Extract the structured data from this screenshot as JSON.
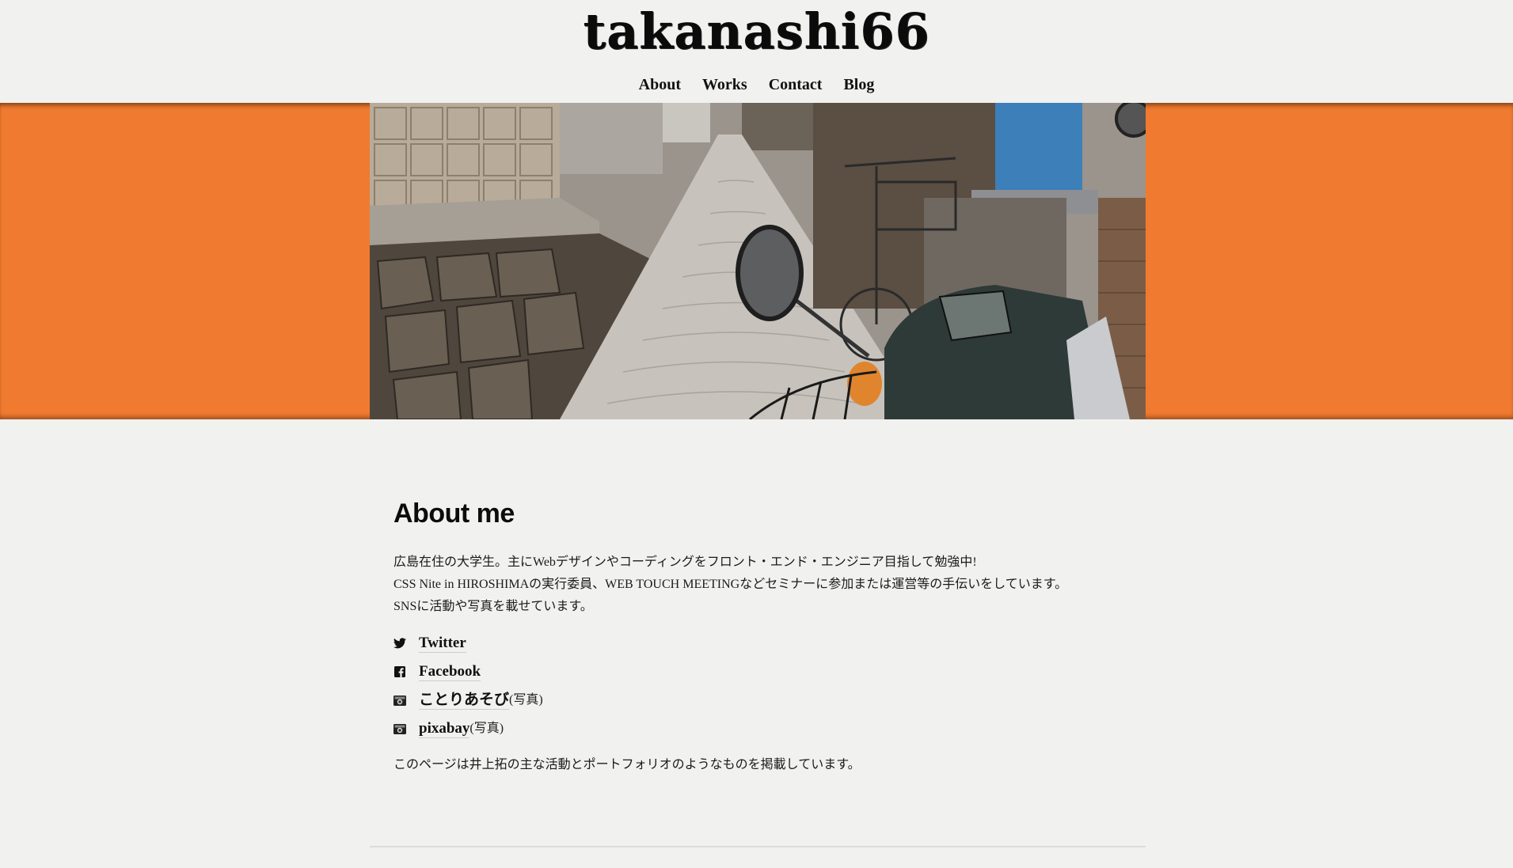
{
  "site": {
    "title": "takanashi66"
  },
  "nav": {
    "items": [
      {
        "label": "About"
      },
      {
        "label": "Works"
      },
      {
        "label": "Contact"
      },
      {
        "label": "Blog"
      }
    ]
  },
  "hero": {
    "band_color": "#f07a2f"
  },
  "about": {
    "title": "About me",
    "lines": [
      "広島在住の大学生。主にWebデザインやコーディングをフロント・エンド・エンジニア目指して勉強中!",
      "CSS Nite in HIROSHIMAの実行委員、WEB TOUCH MEETINGなどセミナーに参加または運営等の手伝いをしています。",
      "SNSに活動や写真を載せています。"
    ],
    "links": [
      {
        "icon": "twitter-icon",
        "label": "Twitter",
        "note": ""
      },
      {
        "icon": "facebook-icon",
        "label": "Facebook",
        "note": ""
      },
      {
        "icon": "camera-icon",
        "label": "ことりあそび",
        "note": "(写真)"
      },
      {
        "icon": "camera-icon",
        "label": "pixabay",
        "note": "(写真)"
      }
    ],
    "closing": "このページは井上拓の主な活動とポートフォリオのようなものを掲載しています。"
  }
}
